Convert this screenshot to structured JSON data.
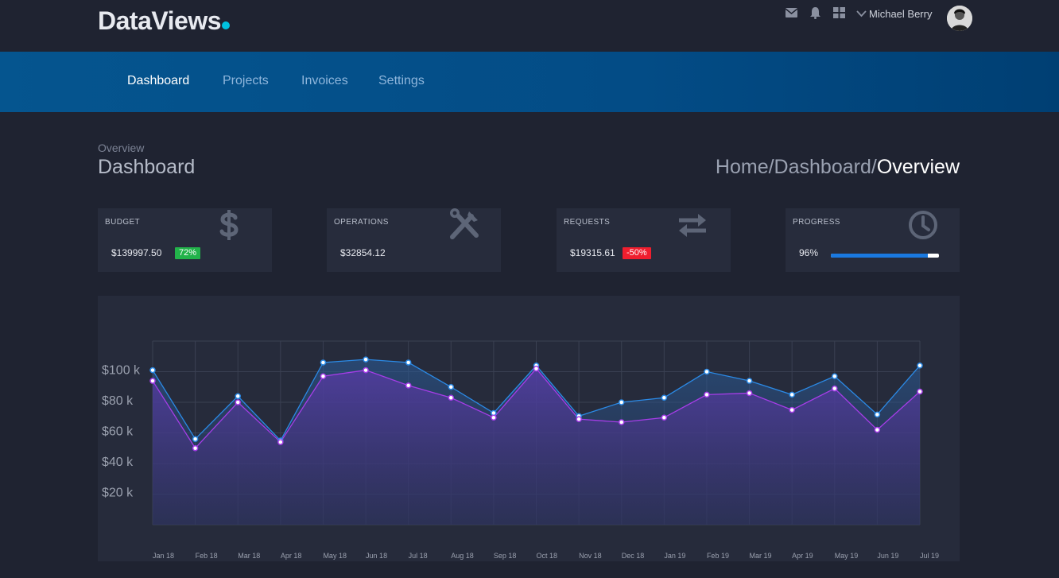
{
  "app": {
    "logo_text": "DataViews",
    "accent": "#00c2e0"
  },
  "header": {
    "icons": [
      "envelope-icon",
      "bell-icon",
      "grid-icon"
    ],
    "username": "Michael Berry"
  },
  "nav": {
    "items": [
      {
        "label": "Dashboard",
        "active": true
      },
      {
        "label": "Projects",
        "active": false
      },
      {
        "label": "Invoices",
        "active": false
      },
      {
        "label": "Settings",
        "active": false
      }
    ]
  },
  "page": {
    "overline": "Overview",
    "title": "Dashboard",
    "breadcrumb": [
      "Home",
      "/",
      "Dashboard",
      "/",
      "Overview"
    ]
  },
  "cards": [
    {
      "label": "BUDGET",
      "value": "$139997.50",
      "badge": "72%",
      "badge_color": "#22b34a",
      "icon": "dollar-icon"
    },
    {
      "label": "OPERATIONS",
      "value": "$32854.12",
      "icon": "tools-icon"
    },
    {
      "label": "REQUESTS",
      "value": "$19315.61",
      "badge": "-50%",
      "badge_color": "#ef1e2e",
      "icon": "transfer-arrows-icon"
    },
    {
      "label": "PROGRESS",
      "value": "96%",
      "progress": 0.9,
      "icon": "clock-icon"
    }
  ],
  "chart_data": {
    "type": "area",
    "x": [
      "Jan 18",
      "Feb 18",
      "Mar 18",
      "Apr 18",
      "May 18",
      "Jun 18",
      "Jul 18",
      "Aug 18",
      "Sep 18",
      "Oct 18",
      "Nov 18",
      "Dec 18",
      "Jan 19",
      "Feb 19",
      "Mar 19",
      "Apr 19",
      "May 19",
      "Jun 19",
      "Jul 19"
    ],
    "y_ticks": [
      "$20 k",
      "$40 k",
      "$60 k",
      "$80 k",
      "$100 k"
    ],
    "ylim": [
      0,
      120000
    ],
    "grid": true,
    "series": [
      {
        "color": "#2b8ae6",
        "values": [
          101000,
          56000,
          84000,
          55000,
          106000,
          108000,
          106000,
          90000,
          73000,
          104000,
          71000,
          80000,
          83000,
          100000,
          94000,
          85000,
          97000,
          72000,
          104000
        ]
      },
      {
        "color": "#a63de8",
        "values": [
          94000,
          50000,
          80000,
          54000,
          97000,
          101000,
          91000,
          83000,
          70000,
          102000,
          69000,
          67000,
          70000,
          85000,
          86000,
          75000,
          89000,
          62000,
          87000
        ]
      }
    ]
  }
}
